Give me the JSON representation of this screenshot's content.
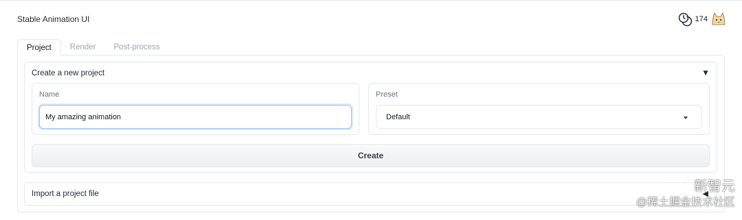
{
  "app": {
    "title": "Stable Animation UI"
  },
  "header": {
    "credits": "174",
    "coin_icon": "coin-icon",
    "avatar_icon": "cat-avatar-icon"
  },
  "tabs": [
    {
      "label": "Project",
      "active": true
    },
    {
      "label": "Render",
      "active": false
    },
    {
      "label": "Post-process",
      "active": false
    }
  ],
  "create_project": {
    "title": "Create a new project",
    "toggle_icon": "▼",
    "name_label": "Name",
    "name_value": "My amazing animation",
    "preset_label": "Preset",
    "preset_value": "Default",
    "create_label": "Create"
  },
  "import_project": {
    "title": "Import a project file",
    "toggle_icon": "◀"
  },
  "watermark": {
    "line1": "新智元",
    "line2": "@稀土掘金技术社区"
  },
  "colors": {
    "accent_focus": "#93c5fd",
    "border": "#e5e7eb",
    "muted_text": "#9ca3af"
  }
}
